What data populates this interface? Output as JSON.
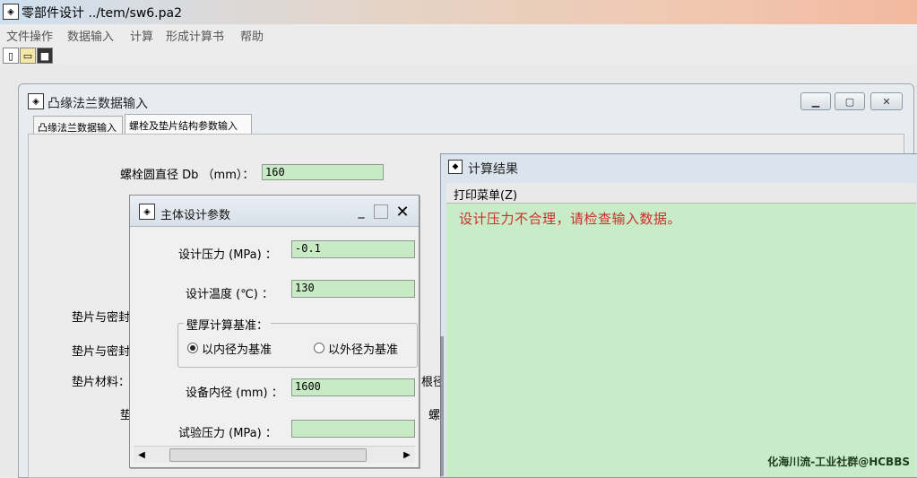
{
  "app": {
    "title": "零部件设计 ../tem/sw6.pa2"
  },
  "menu": [
    "文件操作",
    "数据输入",
    "计算",
    "形成计算书",
    "帮助"
  ],
  "toolbar": {
    "new_icon": "new-file-icon",
    "open_icon": "open-folder-icon",
    "save_icon": "save-disk-icon"
  },
  "flange_window": {
    "title": "凸缘法兰数据输入",
    "tabs": [
      "凸缘法兰数据输入",
      "螺栓及垫片结构参数输入"
    ],
    "bolt_circle_label": "螺栓圆直径 Db （mm）：",
    "bolt_circle_value": "160",
    "gasket_seal_label_1": "垫片与密封",
    "gasket_seal_label_2": "垫片与密封",
    "gasket_material_label": "垫片材料：",
    "gasket_short_label": "垫",
    "root_label": "根径",
    "bolt_short_label": "螺"
  },
  "result_window": {
    "title": "计算结果",
    "menu_print": "打印菜单(Z)",
    "message": "设计压力不合理，请检查输入数据。"
  },
  "param_window": {
    "title": "主体设计参数",
    "design_pressure_label": "设计压力 (MPa) ：",
    "design_pressure_value": "-0.1",
    "design_temp_label": "设计温度 (℃) ：",
    "design_temp_value": "130",
    "wall_basis_label": "壁厚计算基准：",
    "radio_inner_label": "以内径为基准",
    "radio_outer_label": "以外径为基准",
    "radio_selected": "inner",
    "inner_diameter_label": "设备内径 (mm) ：",
    "inner_diameter_value": "1600",
    "test_pressure_label": "试验压力 (MPa) ：",
    "test_pressure_value": ""
  },
  "watermark": "化海川流-工业社群@HCBBS",
  "colors": {
    "field_bg": "#c8ebc6",
    "result_bg": "#c8ebc8",
    "error_text": "#c8302a"
  }
}
